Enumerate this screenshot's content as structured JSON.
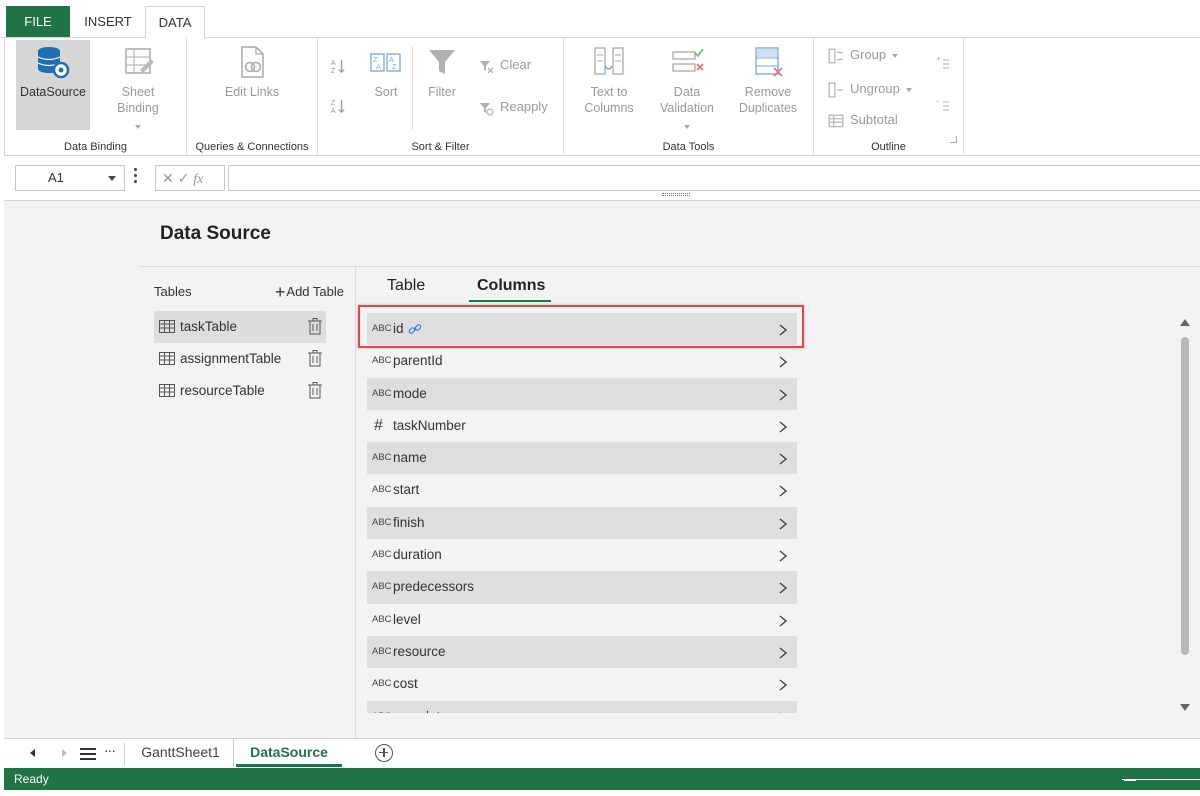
{
  "ribbon": {
    "tabs": [
      "FILE",
      "INSERT",
      "DATA"
    ],
    "groups": {
      "data_binding": {
        "label": "Data Binding",
        "datasource": "DataSource",
        "sheet_binding_1": "Sheet",
        "sheet_binding_2": "Binding"
      },
      "queries": {
        "label": "Queries & Connections",
        "edit_links": "Edit Links"
      },
      "sort_filter": {
        "label": "Sort & Filter",
        "sort": "Sort",
        "filter": "Filter",
        "clear": "Clear",
        "reapply": "Reapply"
      },
      "data_tools": {
        "label": "Data Tools",
        "text_to_columns_1": "Text to",
        "text_to_columns_2": "Columns",
        "data_validation_1": "Data",
        "data_validation_2": "Validation",
        "remove_duplicates_1": "Remove",
        "remove_duplicates_2": "Duplicates"
      },
      "outline": {
        "label": "Outline",
        "group": "Group",
        "ungroup": "Ungroup",
        "subtotal": "Subtotal"
      }
    }
  },
  "formula_bar": {
    "name_box": "A1",
    "formula": ""
  },
  "data_source": {
    "title": "Data Source",
    "tables_label": "Tables",
    "add_table_label": "Add Table",
    "tables": [
      {
        "name": "taskTable",
        "selected": true
      },
      {
        "name": "assignmentTable",
        "selected": false
      },
      {
        "name": "resourceTable",
        "selected": false
      }
    ],
    "subtabs": {
      "table": "Table",
      "columns": "Columns"
    },
    "columns": [
      {
        "name": "id",
        "type": "ABC",
        "linked": true
      },
      {
        "name": "parentId",
        "type": "ABC"
      },
      {
        "name": "mode",
        "type": "ABC"
      },
      {
        "name": "taskNumber",
        "type": "#"
      },
      {
        "name": "name",
        "type": "ABC"
      },
      {
        "name": "start",
        "type": "ABC"
      },
      {
        "name": "finish",
        "type": "ABC"
      },
      {
        "name": "duration",
        "type": "ABC"
      },
      {
        "name": "predecessors",
        "type": "ABC"
      },
      {
        "name": "level",
        "type": "ABC"
      },
      {
        "name": "resource",
        "type": "ABC"
      },
      {
        "name": "cost",
        "type": "ABC"
      },
      {
        "name": "complete",
        "type": "ABC"
      }
    ]
  },
  "sheets": {
    "items": [
      "GanttSheet1",
      "DataSource"
    ],
    "active": "DataSource"
  },
  "status": {
    "text": "Ready"
  },
  "colors": {
    "accent": "#217346",
    "highlight": "#e04848"
  },
  "icons": [
    "database-gear-icon",
    "sheet-binding-icon",
    "edit-links-icon",
    "sort-az-icon",
    "sort-za-icon",
    "sort-dialog-icon",
    "filter-icon",
    "clear-filter-icon",
    "reapply-icon",
    "text-to-columns-icon",
    "data-validation-icon",
    "remove-duplicates-icon",
    "group-icon",
    "ungroup-icon",
    "subtotal-icon",
    "table-grid-icon",
    "trash-icon",
    "link-icon",
    "chevron-right-icon",
    "add-sheet-icon"
  ]
}
